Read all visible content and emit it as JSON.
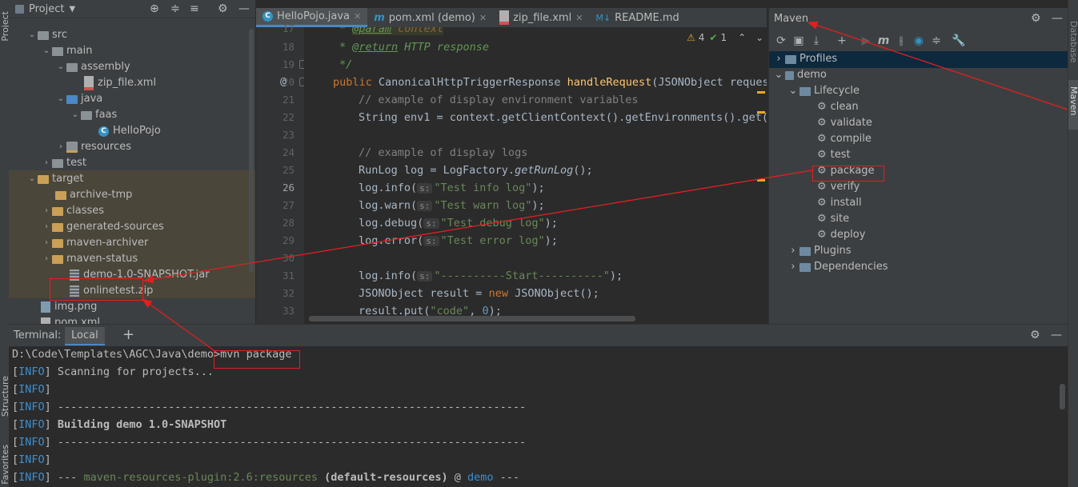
{
  "left_strip": {
    "project_label": "Project",
    "structure_label": "Structure",
    "favorites_label": "Favorites"
  },
  "project": {
    "title": "Project",
    "tree": [
      {
        "label": "src",
        "indent": 0
      },
      {
        "label": "main",
        "indent": 1
      },
      {
        "label": "assembly",
        "indent": 2
      },
      {
        "label": "zip_file.xml",
        "indent": 3
      },
      {
        "label": "java",
        "indent": 2
      },
      {
        "label": "faas",
        "indent": 3
      },
      {
        "label": "HelloPojo",
        "indent": 4
      },
      {
        "label": "resources",
        "indent": 2
      },
      {
        "label": "test",
        "indent": 1
      },
      {
        "label": "target",
        "indent": 0
      },
      {
        "label": "archive-tmp",
        "indent": 1
      },
      {
        "label": "classes",
        "indent": 1
      },
      {
        "label": "generated-sources",
        "indent": 1
      },
      {
        "label": "maven-archiver",
        "indent": 1
      },
      {
        "label": "maven-status",
        "indent": 1
      },
      {
        "label": "demo-1.0-SNAPSHOT.jar",
        "indent": 1
      },
      {
        "label": "onlinetest.zip",
        "indent": 1
      },
      {
        "label": "img.png",
        "indent": 0
      },
      {
        "label": "pom.xml",
        "indent": 0
      }
    ]
  },
  "editor": {
    "tabs": [
      {
        "label": "HelloPojo.java",
        "active": true
      },
      {
        "label": "pom.xml (demo)",
        "active": false
      },
      {
        "label": "zip_file.xml",
        "active": false
      },
      {
        "label": "README.md",
        "active": false
      }
    ],
    "inspections": {
      "warnings": "4",
      "ok": "1"
    },
    "line_numbers": [
      "17",
      "18",
      "19",
      "20",
      "21",
      "22",
      "23",
      "24",
      "25",
      "26",
      "27",
      "28",
      "29",
      "30",
      "31",
      "32",
      "33"
    ],
    "code": {
      "l17_star": "* ",
      "l17_tag": "@param",
      "l17_rest": " context",
      "l18_star": "* ",
      "l18_tag": "@return",
      "l18_rest": " HTTP response",
      "l19": "*/",
      "l20_kw": "public ",
      "l20_type": "CanonicalHttpTriggerResponse ",
      "l20_fn": "handleRequest",
      "l20_rest": "(JSONObject request",
      "l21": "// example of display environment variables",
      "l22": "String env1 = context.getClientContext().getEnvironments().get(",
      "l24": "// example of display logs",
      "l25_a": "RunLog log = LogFactory.",
      "l25_b": "getRunLog",
      "l25_c": "();",
      "l26_a": "log.info(",
      "l26_s": "\"Test info log\"",
      "l26_c": ");",
      "l27_a": "log.warn(",
      "l27_s": "\"Test warn log\"",
      "l27_c": ");",
      "l28_a": "log.debug(",
      "l28_s": "\"Test debug log\"",
      "l28_c": ");",
      "l29_a": "log.error(",
      "l29_s": "\"Test error log\"",
      "l29_c": ");",
      "l31_a": "log.info(",
      "l31_s": "\"----------Start----------\"",
      "l31_c": ");",
      "l32_a": "JSONObject result = ",
      "l32_kw": "new ",
      "l32_b": "JSONObject();",
      "l33_a": "result.put(",
      "l33_s": "\"code\"",
      "l33_b": ", ",
      "l33_n": "0",
      "l33_c": ");",
      "hint": "s:"
    }
  },
  "maven": {
    "title": "Maven",
    "tree": [
      {
        "label": "Profiles"
      },
      {
        "label": "demo"
      },
      {
        "label": "Lifecycle"
      },
      {
        "label": "clean"
      },
      {
        "label": "validate"
      },
      {
        "label": "compile"
      },
      {
        "label": "test"
      },
      {
        "label": "package"
      },
      {
        "label": "verify"
      },
      {
        "label": "install"
      },
      {
        "label": "site"
      },
      {
        "label": "deploy"
      },
      {
        "label": "Plugins"
      },
      {
        "label": "Dependencies"
      }
    ]
  },
  "right_strip": {
    "database_label": "Database",
    "maven_label": "Maven"
  },
  "terminal": {
    "title": "Terminal:",
    "tab": "Local",
    "prompt": "D:\\Code\\Templates\\AGC\\Java\\demo>",
    "command": "mvn package",
    "info": "INFO",
    "lines": {
      "l2": " Scanning for projects...",
      "l4": " ------------------------------------------------------------------------",
      "l5": " Building demo 1.0-SNAPSHOT",
      "l6": " ------------------------------------------------------------------------",
      "l8_a": " --- ",
      "l8_plugin": "maven-resources-plugin:2.6:resources",
      "l8_b": " (default-resources)",
      "l8_c": " @ ",
      "l8_d": "demo",
      "l8_e": " ---"
    }
  }
}
